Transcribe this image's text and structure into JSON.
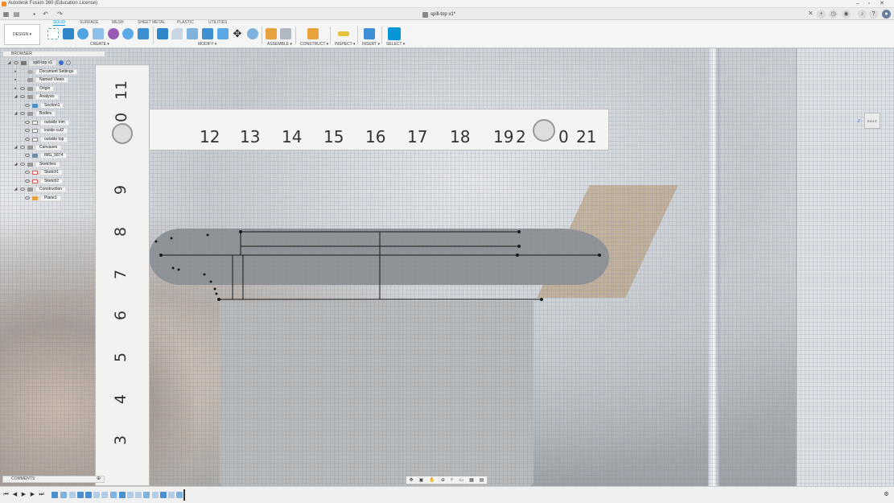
{
  "window": {
    "title": "Autodesk Fusion 360 (Education License)"
  },
  "document_tab": {
    "name": "spill-top v1*"
  },
  "ribbon": {
    "tabs": [
      "SOLID",
      "SURFACE",
      "MESH",
      "SHEET METAL",
      "PLASTIC",
      "UTILITIES"
    ],
    "active_tab": "SOLID",
    "workspace": "DESIGN ▾",
    "groups": [
      "CREATE ▾",
      "MODIFY ▾",
      "ASSEMBLE ▾",
      "CONSTRUCT ▾",
      "INSPECT ▾",
      "INSERT ▾",
      "SELECT ▾"
    ]
  },
  "browser": {
    "header": "BROWSER",
    "root": "spill-top v1",
    "items": [
      {
        "label": "Document Settings"
      },
      {
        "label": "Named Views"
      },
      {
        "label": "Origin"
      },
      {
        "label": "Analysis"
      },
      {
        "label": "Section1"
      },
      {
        "label": "Bodies"
      },
      {
        "label": "outside trim"
      },
      {
        "label": "inside-cut2"
      },
      {
        "label": "outside top"
      },
      {
        "label": "Canvases"
      },
      {
        "label": "IMG_5874"
      },
      {
        "label": "Sketches"
      },
      {
        "label": "Sketch1"
      },
      {
        "label": "Sketch2"
      },
      {
        "label": "Construction"
      },
      {
        "label": "Plane1"
      }
    ]
  },
  "comments": {
    "label": "COMMENTS"
  },
  "viewcube": {
    "face": "RIGHT",
    "axis_z": "Z"
  },
  "ruler": {
    "vertical_numbers": [
      "11",
      "10",
      "9",
      "8",
      "7",
      "6",
      "5",
      "4",
      "3"
    ],
    "horizontal_numbers": [
      "12",
      "13",
      "14",
      "15",
      "16",
      "17",
      "18",
      "19",
      "2",
      "0",
      "21"
    ]
  },
  "icons": {
    "grid": "grid-icon",
    "file": "file-icon",
    "save": "save-icon",
    "undo": "undo-icon",
    "redo": "redo-icon",
    "add": "plus-icon",
    "help": "help-icon",
    "notifications": "bell-icon",
    "profile": "avatar-icon"
  },
  "colors": {
    "accent": "#0696d7",
    "select_tool": "#0696d7"
  }
}
